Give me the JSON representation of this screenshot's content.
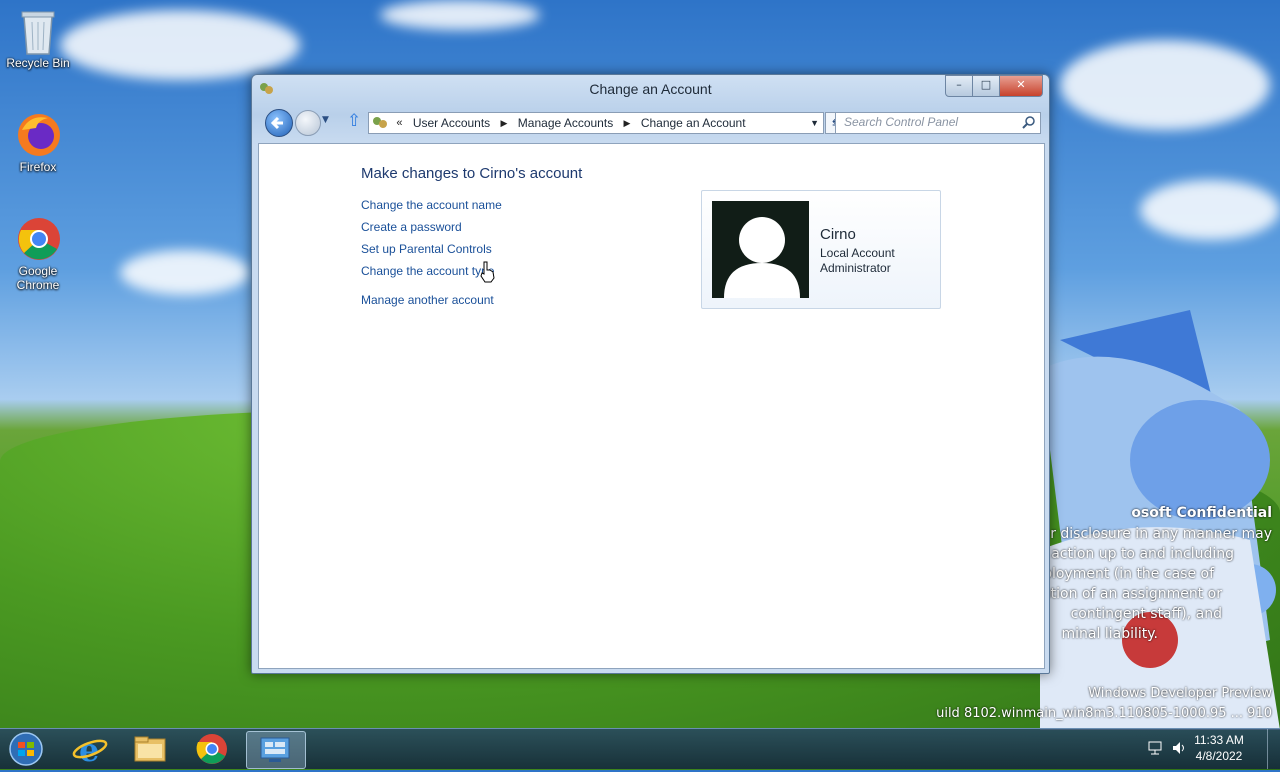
{
  "desktop": {
    "icons": [
      {
        "label": "Recycle Bin",
        "icon": "recycle-bin-icon"
      },
      {
        "label": "Firefox",
        "icon": "firefox-icon"
      },
      {
        "label": "Google Chrome",
        "icon": "chrome-icon"
      }
    ],
    "watermark": {
      "lines": [
        "osoft Confidential",
        "r disclosure in any manner may",
        "y action up to and including",
        "ployment (in the case of",
        "ation of an assignment or",
        "contingent staff), and",
        "minal liability.",
        "Windows Developer Preview",
        "uild 8102.winmain_win8m3.110805-1000.95 ... 910"
      ]
    }
  },
  "window": {
    "title": "Change an Account",
    "controls": {
      "minimize": "–",
      "maximize": "□",
      "close": "✕"
    },
    "breadcrumb": {
      "prefix": "«",
      "items": [
        "User Accounts",
        "Manage Accounts",
        "Change an Account"
      ]
    },
    "search": {
      "placeholder": "Search Control Panel"
    },
    "heading": "Make changes to Cirno's account",
    "links": [
      "Change the account name",
      "Create a password",
      "Set up Parental Controls",
      "Change the account type",
      "Manage another account"
    ],
    "account": {
      "name": "Cirno",
      "type": "Local Account",
      "role": "Administrator"
    }
  },
  "taskbar": {
    "items": [
      "start-orb-icon",
      "internet-explorer-icon",
      "file-explorer-icon",
      "chrome-icon",
      "control-panel-icon"
    ],
    "clock": {
      "time": "11:33 AM",
      "date": "4/8/2022"
    }
  },
  "colors": {
    "link": "#1a5099",
    "heading": "#1e3a6f",
    "taskbar": "#1f3a55"
  }
}
